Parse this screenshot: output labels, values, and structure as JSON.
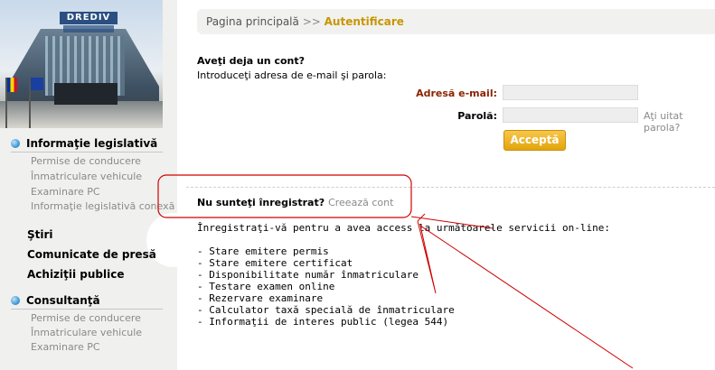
{
  "banner": {
    "sign_text": "DREDIV"
  },
  "sidebar": {
    "sections": [
      {
        "title": "Informaţie legislativă",
        "items": [
          "Permise de conducere",
          "Înmatriculare vehicule",
          "Examinare PC",
          "Informaţie legislativă conexă"
        ]
      },
      {
        "title": "Consultanţă",
        "items": [
          "Permise de conducere",
          "Înmatriculare vehicule",
          "Examinare PC"
        ]
      }
    ],
    "links": [
      "Ştiri",
      "Comunicate de presă",
      "Achiziţii publice"
    ]
  },
  "breadcrumb": {
    "home": "Pagina principală",
    "separator": ">>",
    "current": "Autentificare"
  },
  "login": {
    "heading": "Aveţi deja un cont?",
    "instructions": "Introduceţi adresa de e-mail şi parola:",
    "email_label": "Adresă e-mail:",
    "email_value": "",
    "password_label": "Parolă:",
    "password_value": "",
    "forgot_link": "Aţi uitat parola?",
    "submit_label": "Acceptă"
  },
  "register": {
    "question": "Nu sunteţi înregistrat?",
    "create_link": "Creează cont",
    "intro": "Înregistraţi-vă pentru a avea access la următoarele servicii on-line:",
    "services": [
      "- Stare emitere permis",
      "- Stare emitere certificat",
      "- Disponibilitate număr înmatriculare",
      "- Testare examen online",
      "- Rezervare examinare",
      "- Calculator taxă specială de înmatriculare",
      "- Informaţii de interes public (legea 544)"
    ]
  },
  "colors": {
    "accent": "#c89600",
    "email_label": "#8b2500",
    "annotation": "#d00000",
    "button": "#f0b429"
  }
}
